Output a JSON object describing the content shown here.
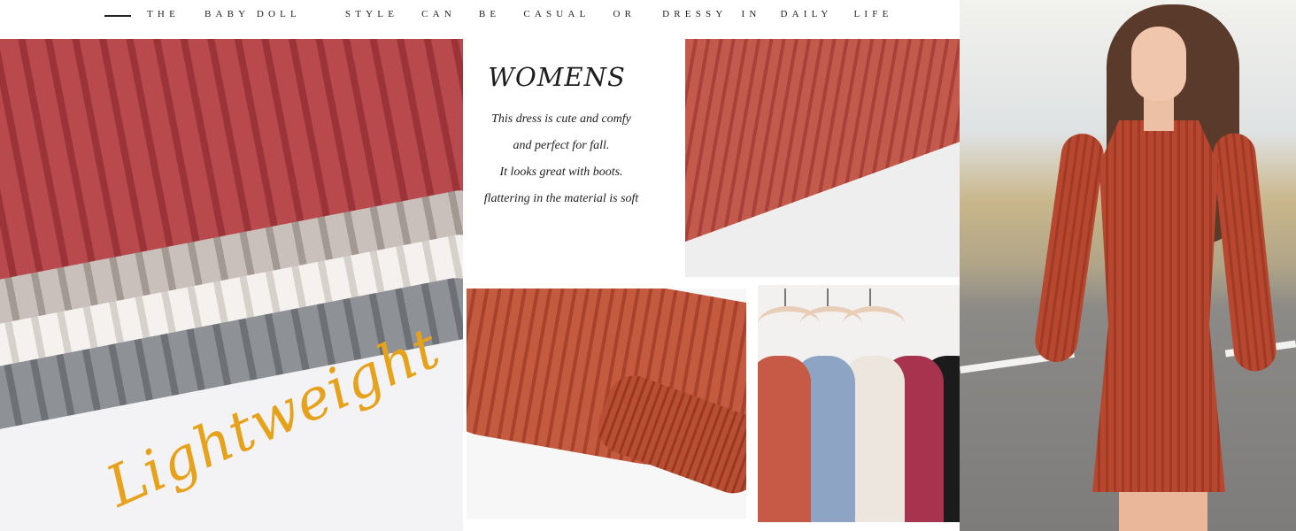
{
  "header": {
    "words": [
      "THE",
      "BABY DOLL",
      "STYLE",
      "CAN",
      "BE",
      "CASUAL",
      "OR",
      "DRESSY",
      "IN",
      "DAILY",
      "LIFE"
    ]
  },
  "fabrics": {
    "script_text": "Lightweight"
  },
  "description": {
    "title": "WOMENS",
    "lines": [
      "This dress is cute and comfy",
      "and perfect for fall.",
      "It looks great with boots.",
      "flattering in the material is soft"
    ]
  },
  "colors": {
    "accent_gold": "#e7a21c",
    "dress_rust": "#b8472f",
    "hanger_colors": [
      "#c75a46",
      "#8ea4c4",
      "#ece6df",
      "#a8334f",
      "#1b1b1b"
    ]
  }
}
